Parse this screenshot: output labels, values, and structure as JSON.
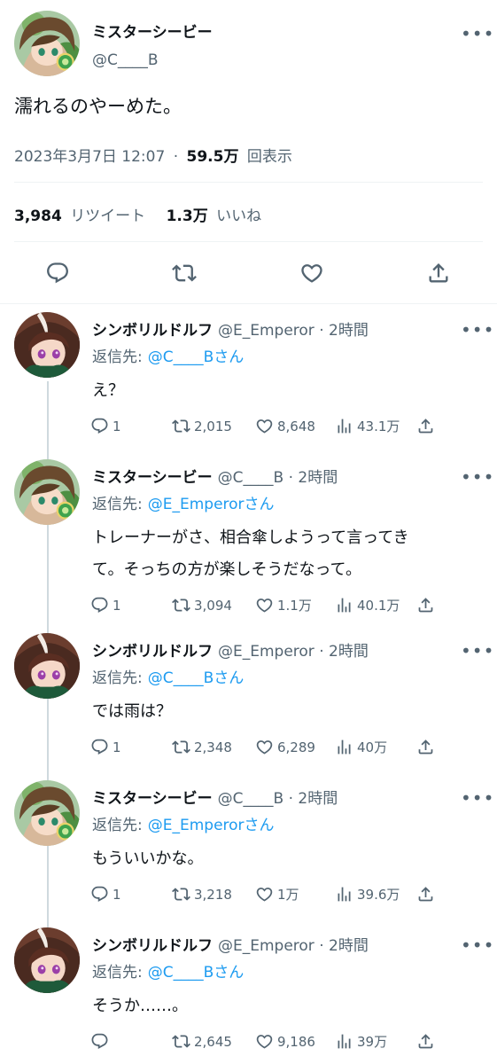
{
  "main_tweet": {
    "author_name": "ミスターシービー",
    "handle": "@C____B",
    "text": "濡れるのやーめた。",
    "timestamp": "2023年3月7日 12:07",
    "separator": "·",
    "views_count": "59.5万",
    "views_label": "回表示",
    "retweets_count": "3,984",
    "retweets_label": "リツイート",
    "likes_count": "1.3万",
    "likes_label": "いいね"
  },
  "replies": [
    {
      "author_name": "シンボリルドルフ",
      "meta": "@E_Emperor · 2時間",
      "reply_to_label": "返信先:",
      "reply_to": "@C____Bさん",
      "text_lines": [
        "え？"
      ],
      "replies": "1",
      "retweets": "2,015",
      "likes": "8,648",
      "views": "43.1万"
    },
    {
      "author_name": "ミスターシービー",
      "meta": "@C____B · 2時間",
      "reply_to_label": "返信先:",
      "reply_to": "@E_Emperorさん",
      "text_lines": [
        "トレーナーがさ、相合傘しようって言ってき",
        "て。そっちの方が楽しそうだなって。"
      ],
      "replies": "1",
      "retweets": "3,094",
      "likes": "1.1万",
      "views": "40.1万"
    },
    {
      "author_name": "シンボリルドルフ",
      "meta": "@E_Emperor · 2時間",
      "reply_to_label": "返信先:",
      "reply_to": "@C____Bさん",
      "text_lines": [
        "では雨は？"
      ],
      "replies": "1",
      "retweets": "2,348",
      "likes": "6,289",
      "views": "40万"
    },
    {
      "author_name": "ミスターシービー",
      "meta": "@C____B · 2時間",
      "reply_to_label": "返信先:",
      "reply_to": "@E_Emperorさん",
      "text_lines": [
        "もういいかな。"
      ],
      "replies": "1",
      "retweets": "3,218",
      "likes": "1万",
      "views": "39.6万"
    },
    {
      "author_name": "シンボリルドルフ",
      "meta": "@E_Emperor · 2時間",
      "reply_to_label": "返信先:",
      "reply_to": "@C____Bさん",
      "text_lines": [
        "そうか……。"
      ],
      "replies": "",
      "retweets": "2,645",
      "likes": "9,186",
      "views": "39万"
    }
  ],
  "icons": {
    "more": "more-icon",
    "reply": "reply-icon",
    "retweet": "retweet-icon",
    "like": "like-icon",
    "views": "views-icon",
    "share": "share-icon"
  },
  "colors": {
    "text": "#0f1419",
    "muted": "#536471",
    "link": "#1d9bf0",
    "divider": "#eff3f4",
    "thread_line": "#cfd9de"
  }
}
